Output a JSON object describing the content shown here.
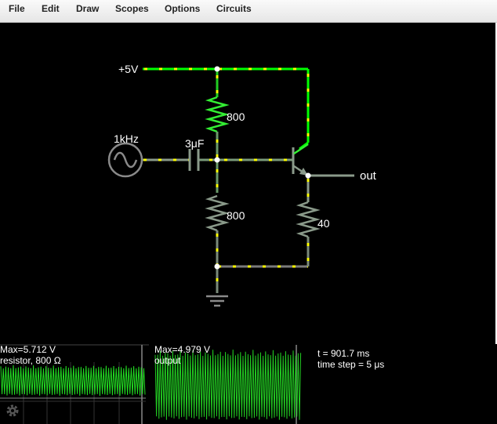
{
  "menu": {
    "file": "File",
    "edit": "Edit",
    "draw": "Draw",
    "scopes": "Scopes",
    "options": "Options",
    "circuits": "Circuits"
  },
  "circuit": {
    "supply_label": "+5V",
    "source_label": "1kHz",
    "capacitor_label": "3μF",
    "r1_label": "800",
    "r2_label": "800",
    "re_label": "40",
    "output_label": "out"
  },
  "scope1": {
    "max_label": "Max=5.712 V",
    "element_label": "resistor, 800 Ω"
  },
  "scope2": {
    "max_label": "Max=4.979 V",
    "element_label": "output"
  },
  "info": {
    "time": "t = 901.7 ms",
    "timestep": "time step = 5 μs"
  },
  "icons": {
    "settings": "gear-icon"
  },
  "colors": {
    "wire_live": "#00ff00",
    "wire_dim": "#7a8a7a",
    "current_dots": "#ffff00",
    "waveform": "#00cc00",
    "background": "#000000"
  }
}
